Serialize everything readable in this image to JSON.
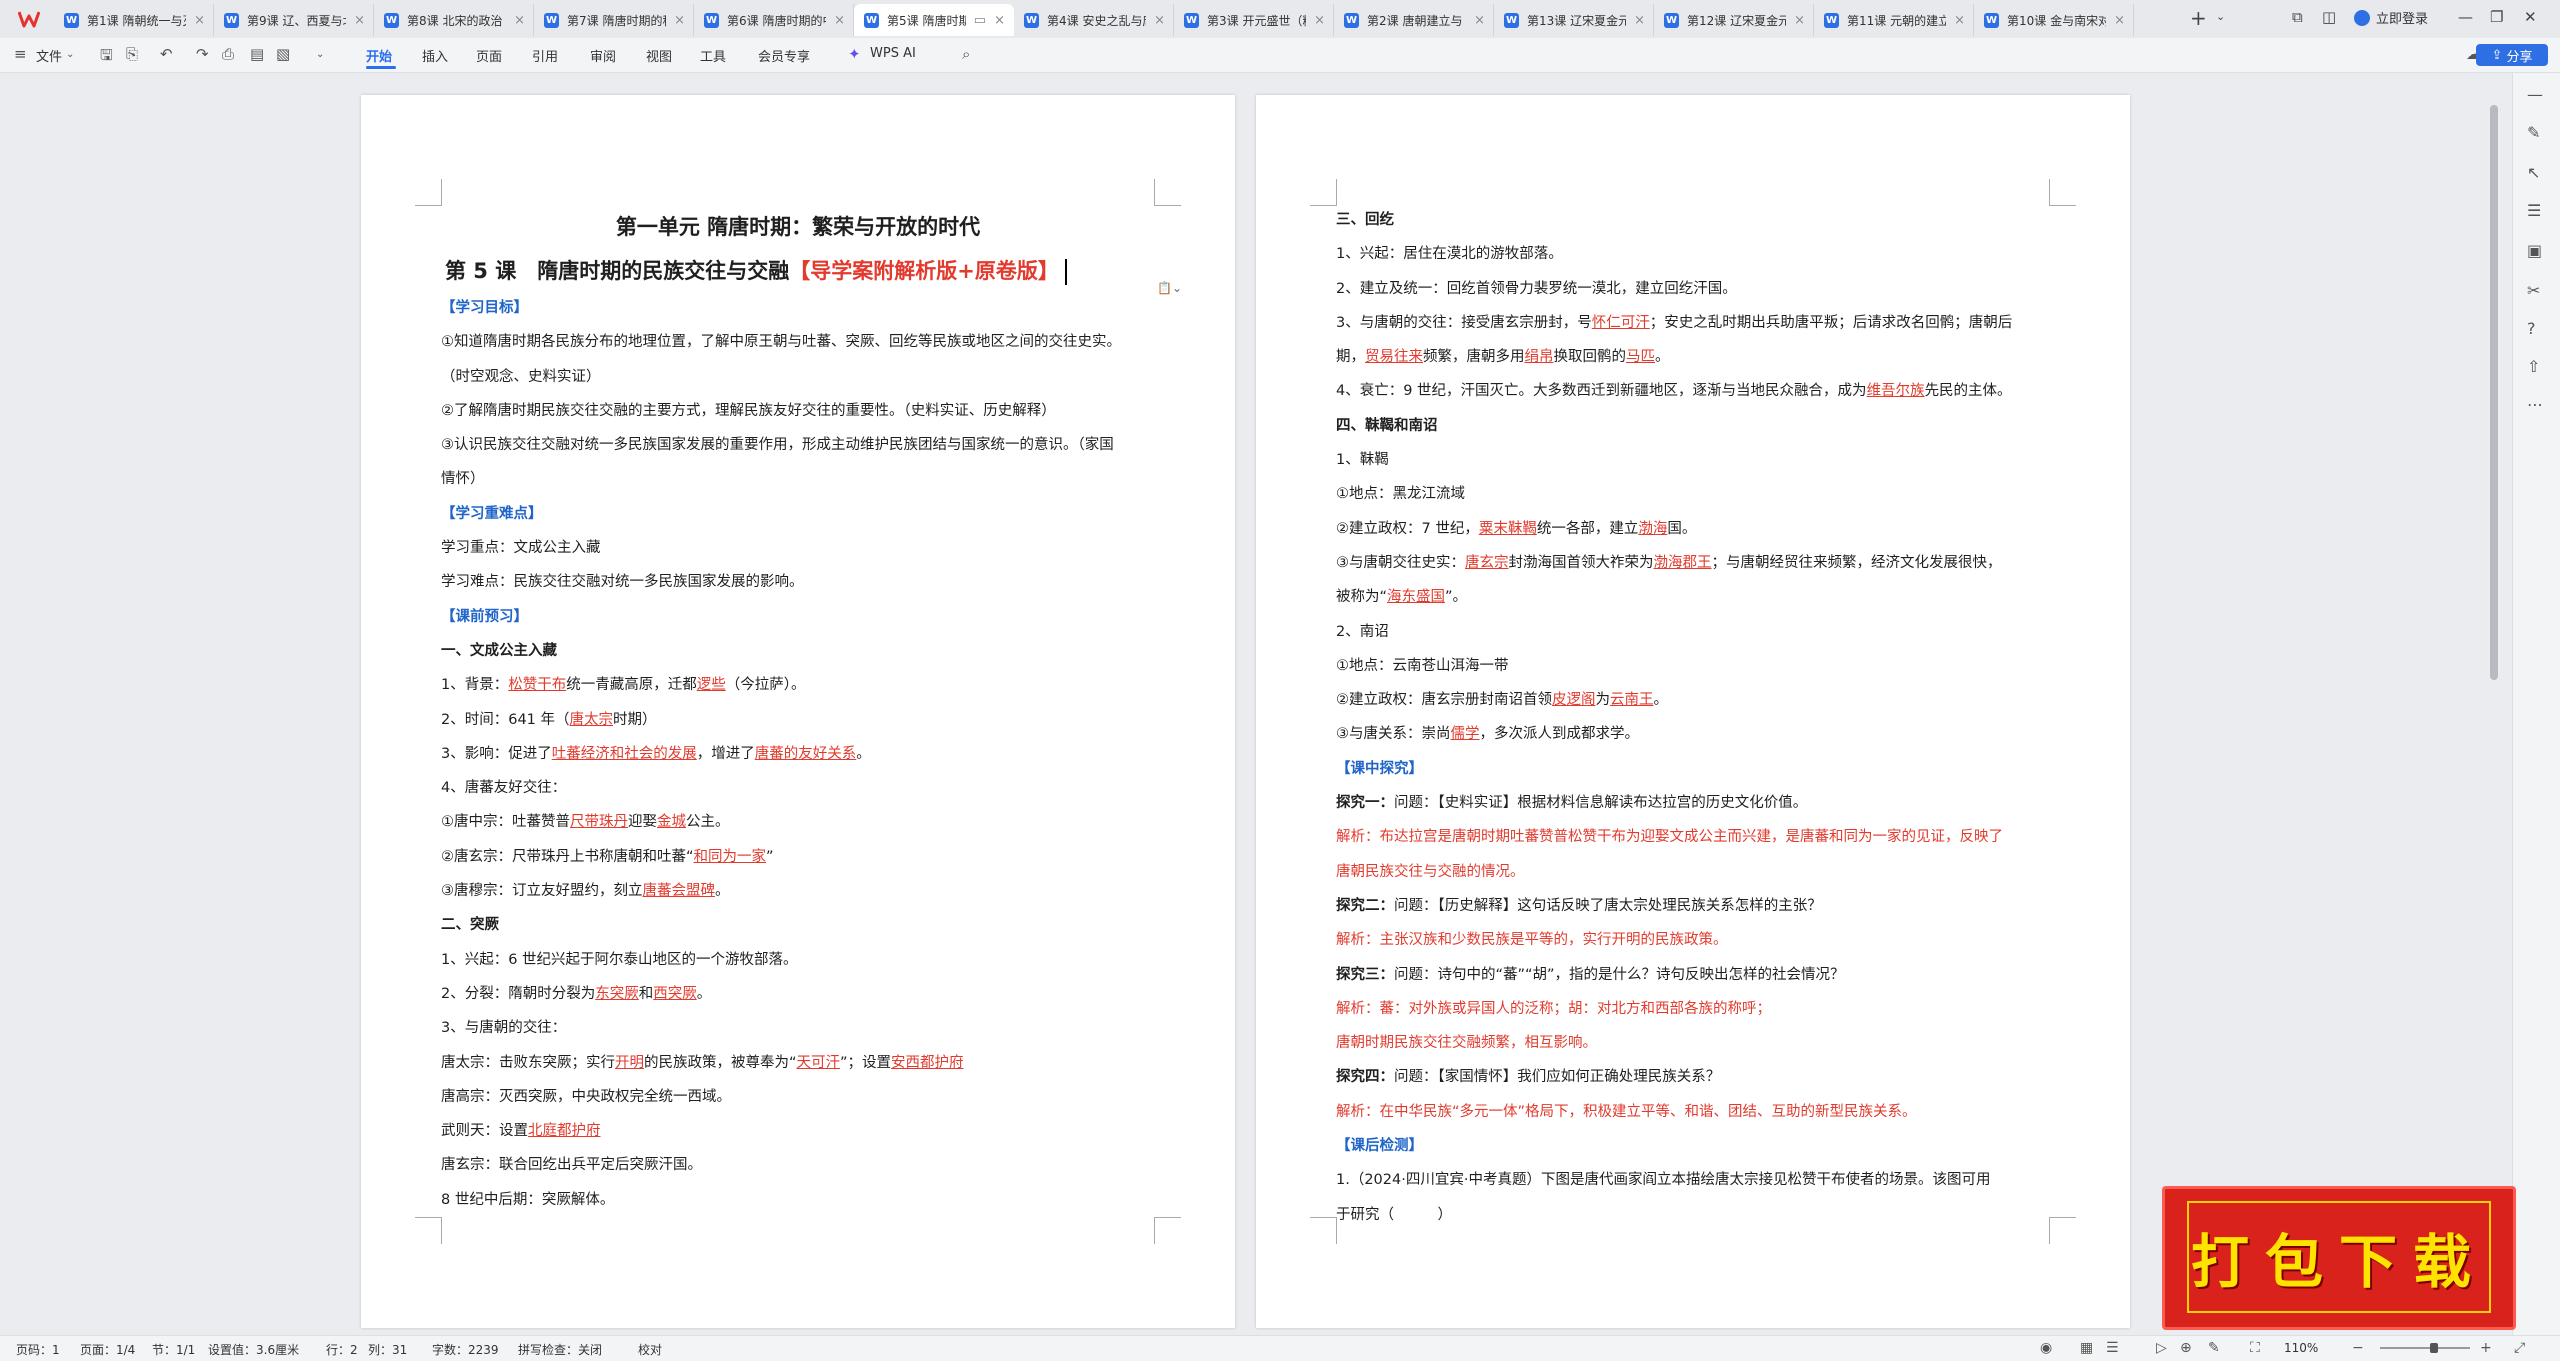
{
  "tabs": [
    {
      "label": "第1课 隋朝统一与灭"
    },
    {
      "label": "第9课 辽、西夏与北"
    },
    {
      "label": "第8课 北宋的政治"
    },
    {
      "label": "第7课 隋唐时期的科"
    },
    {
      "label": "第6课 隋唐时期的中"
    },
    {
      "label": "第5课 隋唐时期"
    },
    {
      "label": "第4课 安史之乱与唐"
    },
    {
      "label": "第3课 开元盛世（精"
    },
    {
      "label": "第2课 唐朝建立与"
    },
    {
      "label": "第13课 辽宋夏金元"
    },
    {
      "label": "第12课 辽宋夏金元"
    },
    {
      "label": "第11课 元朝的建立"
    },
    {
      "label": "第10课 金与南宋对"
    }
  ],
  "tab_icon_letter": "W",
  "login_label": "立即登录",
  "toolbar": {
    "file_label": "文件",
    "menus": [
      "开始",
      "插入",
      "页面",
      "引用",
      "审阅",
      "视图",
      "工具",
      "会员专享"
    ],
    "ai_label": "WPS AI",
    "share_label": "分享"
  },
  "page1": {
    "unit_title": "第一单元 隋唐时期：繁荣与开放的时代",
    "lesson_title": "第 5 课　隋唐时期的民族交往与交融",
    "lesson_title_red": "【导学案附解析版+原卷版】",
    "lines": [
      {
        "t": "【学习目标】",
        "c": "blue"
      },
      {
        "t": "①知道隋唐时期各民族分布的地理位置，了解中原王朝与吐蕃、突厥、回纥等民族或地区之间的交往史实。"
      },
      {
        "t": "（时空观念、史料实证）"
      },
      {
        "t": "②了解隋唐时期民族交往交融的主要方式，理解民族友好交往的重要性。（史料实证、历史解释）"
      },
      {
        "t": "③认识民族交往交融对统一多民族国家发展的重要作用，形成主动维护民族团结与国家统一的意识。（家国"
      },
      {
        "t": "情怀）"
      },
      {
        "t": "【学习重难点】",
        "c": "blue"
      },
      {
        "t": "学习重点：文成公主入藏"
      },
      {
        "t": "学习难点：民族交往交融对统一多民族国家发展的影响。"
      },
      {
        "t": "【课前预习】",
        "c": "blue"
      },
      {
        "t": "一、文成公主入藏",
        "c": "bold"
      },
      {
        "t": "1、背景：",
        "u": "松赞干布",
        "t2": "统一青藏高原，迁都",
        "u2": "逻些",
        "t3": "（今拉萨）。"
      },
      {
        "t": "2、时间：641 年（",
        "u": "唐太宗",
        "t2": "时期）"
      },
      {
        "t": "3、影响：促进了",
        "u": "吐蕃经济和社会的发展",
        "t2": "，增进了",
        "u2": "唐蕃的友好关系",
        "t3": "。"
      },
      {
        "t": "4、唐蕃友好交往："
      },
      {
        "t": "①唐中宗：吐蕃赞普",
        "u": "尺带珠丹",
        "t2": "迎娶",
        "u2": "金城",
        "t3": "公主。"
      },
      {
        "t": "②唐玄宗：尺带珠丹上书称唐朝和吐蕃“",
        "u": "和同为一家",
        "t2": "”"
      },
      {
        "t": "③唐穆宗：订立友好盟约，刻立",
        "u": "唐蕃会盟碑",
        "t2": "。"
      },
      {
        "t": "二、突厥",
        "c": "bold"
      },
      {
        "t": "1、兴起：6 世纪兴起于阿尔泰山地区的一个游牧部落。"
      },
      {
        "t": "2、分裂：隋朝时分裂为",
        "u": "东突厥",
        "t2": "和",
        "u2": "西突厥",
        "t3": "。"
      },
      {
        "t": "3、与唐朝的交往："
      },
      {
        "t": "唐太宗：击败东突厥；实行",
        "u": "开明",
        "t2": "的民族政策，被尊奉为“",
        "u2": "天可汗",
        "t3": "”；设置",
        "u3": "安西都护府"
      },
      {
        "t": "唐高宗：灭西突厥，中央政权完全统一西域。"
      },
      {
        "t": "武则天：设置",
        "u": "北庭都护府"
      },
      {
        "t": "唐玄宗：联合回纥出兵平定后突厥汗国。"
      },
      {
        "t": "8 世纪中后期：突厥解体。"
      }
    ]
  },
  "page2": {
    "lines": [
      {
        "t": "三、回纥",
        "c": "bold"
      },
      {
        "t": "1、兴起：居住在漠北的游牧部落。"
      },
      {
        "t": "2、建立及统一：回纥首领骨力裴罗统一漠北，建立回纥汗国。"
      },
      {
        "t": "3、与唐朝的交往：接受唐玄宗册封，号",
        "u": "怀仁可汗",
        "t2": "；安史之乱时期出兵助唐平叛；后请求改名回鹘；唐朝后"
      },
      {
        "t": "期，",
        "u": "贸易往来",
        "t2": "频繁，唐朝多用",
        "u2": "绢帛",
        "t3": "换取回鹘的",
        "u3": "马匹",
        "t4": "。"
      },
      {
        "t": "4、衰亡：9 世纪，汗国灭亡。大多数西迁到新疆地区，逐渐与当地民众融合，成为",
        "u": "维吾尔族",
        "t2": "先民的主体。"
      },
      {
        "t": "四、靺鞨和南诏",
        "c": "bold"
      },
      {
        "t": "1、靺鞨"
      },
      {
        "t": "①地点：黑龙江流域"
      },
      {
        "t": "②建立政权：7 世纪，",
        "u": "粟末靺鞨",
        "t2": "统一各部，建立",
        "u2": "渤海",
        "t3": "国。"
      },
      {
        "t": "③与唐朝交往史实：",
        "u": "唐玄宗",
        "t2": "封渤海国首领大祚荣为",
        "u2": "渤海郡王",
        "t3": "；与唐朝经贸往来频繁，经济文化发展很快，"
      },
      {
        "t": "被称为“",
        "u": "海东盛国",
        "t2": "”。"
      },
      {
        "t": "2、南诏"
      },
      {
        "t": "①地点：云南苍山洱海一带"
      },
      {
        "t": "②建立政权：唐玄宗册封南诏首领",
        "u": "皮逻阁",
        "t2": "为",
        "u2": "云南王",
        "t3": "。"
      },
      {
        "t": "③与唐关系：崇尚",
        "u": "儒学",
        "t2": "，多次派人到成都求学。"
      },
      {
        "t": "【课中探究】",
        "c": "blue"
      },
      {
        "b": "探究一：",
        "t": "问题：【史料实证】根据材料信息解读布达拉宫的历史文化价值。"
      },
      {
        "t": "解析：布达拉宫是唐朝时期吐蕃赞普松赞干布为迎娶文成公主而兴建，是唐蕃和同为一家的见证，反映了",
        "c": "red"
      },
      {
        "t": "唐朝民族交往与交融的情况。",
        "c": "red"
      },
      {
        "b": "探究二：",
        "t": "问题：【历史解释】这句话反映了唐太宗处理民族关系怎样的主张？"
      },
      {
        "t": "解析：主张汉族和少数民族是平等的，实行开明的民族政策。",
        "c": "red"
      },
      {
        "b": "探究三：",
        "t": "问题：诗句中的“蕃”“胡”，指的是什么？诗句反映出怎样的社会情况？"
      },
      {
        "t": "解析：蕃：对外族或异国人的泛称；胡：对北方和西部各族的称呼；",
        "c": "red"
      },
      {
        "t": "唐朝时期民族交往交融频繁，相互影响。",
        "c": "red"
      },
      {
        "b": "探究四：",
        "t": "问题：【家国情怀】我们应如何正确处理民族关系？"
      },
      {
        "t": "解析：在中华民族“多元一体”格局下，积极建立平等、和谐、团结、互助的新型民族关系。",
        "c": "red"
      },
      {
        "t": "【课后检测】",
        "c": "blue"
      },
      {
        "t": "1.（2024·四川宜宾·中考真题）下图是唐代画家阎立本描绘唐太宗接见松赞干布使者的场景。该图可用"
      },
      {
        "t": "于研究（　　　）"
      }
    ]
  },
  "download_badge": "打包下载",
  "status": {
    "page_code": "页码：1",
    "page": "页面：1/4",
    "section": "节：1/1",
    "setting": "设置值：3.6厘米",
    "row": "行：2",
    "col": "列：31",
    "words": "字数：2239",
    "spell": "拼写检查：关闭",
    "proof": "校对",
    "zoom": "110%"
  },
  "colors": {
    "accent": "#2f6fe4",
    "red": "#e23b2e",
    "heading_blue": "#1f64c9",
    "badge_red": "#d9221c",
    "badge_yellow": "#ffe300"
  }
}
